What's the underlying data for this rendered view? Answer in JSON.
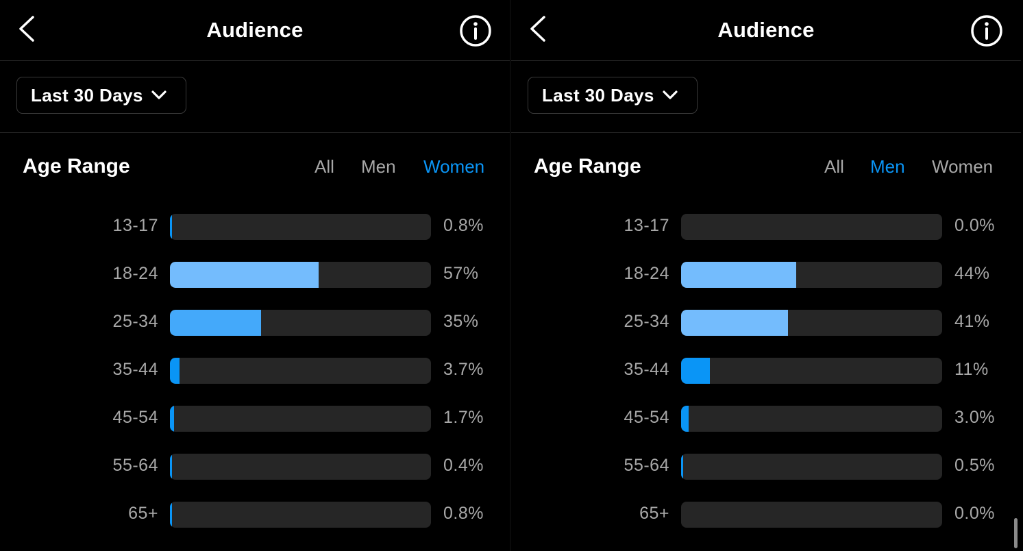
{
  "panels": [
    {
      "title": "Audience",
      "date_filter": "Last 30 Days",
      "section_title": "Age Range",
      "segments": [
        {
          "label": "All",
          "active": false
        },
        {
          "label": "Men",
          "active": false
        },
        {
          "label": "Women",
          "active": true
        }
      ],
      "rows": [
        {
          "label": "13-17",
          "value": "0.8%",
          "percent": 0.8
        },
        {
          "label": "18-24",
          "value": "57%",
          "percent": 57
        },
        {
          "label": "25-34",
          "value": "35%",
          "percent": 35
        },
        {
          "label": "35-44",
          "value": "3.7%",
          "percent": 3.7
        },
        {
          "label": "45-54",
          "value": "1.7%",
          "percent": 1.7
        },
        {
          "label": "55-64",
          "value": "0.4%",
          "percent": 0.4
        },
        {
          "label": "65+",
          "value": "0.8%",
          "percent": 0.8
        }
      ],
      "show_scrollbar": false
    },
    {
      "title": "Audience",
      "date_filter": "Last 30 Days",
      "section_title": "Age Range",
      "segments": [
        {
          "label": "All",
          "active": false
        },
        {
          "label": "Men",
          "active": true
        },
        {
          "label": "Women",
          "active": false
        }
      ],
      "rows": [
        {
          "label": "13-17",
          "value": "0.0%",
          "percent": 0.0
        },
        {
          "label": "18-24",
          "value": "44%",
          "percent": 44
        },
        {
          "label": "25-34",
          "value": "41%",
          "percent": 41
        },
        {
          "label": "35-44",
          "value": "11%",
          "percent": 11
        },
        {
          "label": "45-54",
          "value": "3.0%",
          "percent": 3.0
        },
        {
          "label": "55-64",
          "value": "0.5%",
          "percent": 0.5
        },
        {
          "label": "65+",
          "value": "0.0%",
          "percent": 0.0
        }
      ],
      "show_scrollbar": true
    }
  ],
  "colors": {
    "accent": "#0a95f6",
    "bar_light": "#74bcfd",
    "bar_mid": "#44a9fa",
    "bar_dark": "#0a95f6",
    "track": "#262626",
    "muted_text": "#a8a8a8"
  },
  "icons": {
    "back": "chevron-left-icon",
    "info": "info-circle-icon",
    "dropdown": "chevron-down-icon"
  }
}
